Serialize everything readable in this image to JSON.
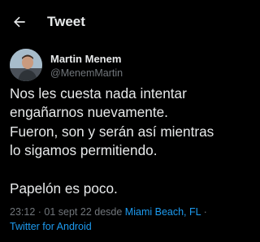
{
  "header": {
    "title": "Tweet",
    "back_icon": "arrow-left-icon"
  },
  "author": {
    "name": "Martin Menem",
    "handle": "@MenemMartin"
  },
  "tweet": {
    "lines": [
      "Nos les cuesta nada intentar",
      "engañarnos nuevamente.",
      "Fueron, son y serán así mientras",
      "lo sigamos permitiendo.",
      "Papelón es poco."
    ]
  },
  "meta": {
    "time": "23:12",
    "sep1": " · ",
    "date": "01 sept 22",
    "desde": " desde ",
    "location": "Miami Beach, FL",
    "sep2": " ·",
    "source": "Twitter for Android"
  },
  "colors": {
    "background": "#000000",
    "text": "#e7e9ea",
    "secondary": "#71767b",
    "accent": "#1d9bf0"
  }
}
